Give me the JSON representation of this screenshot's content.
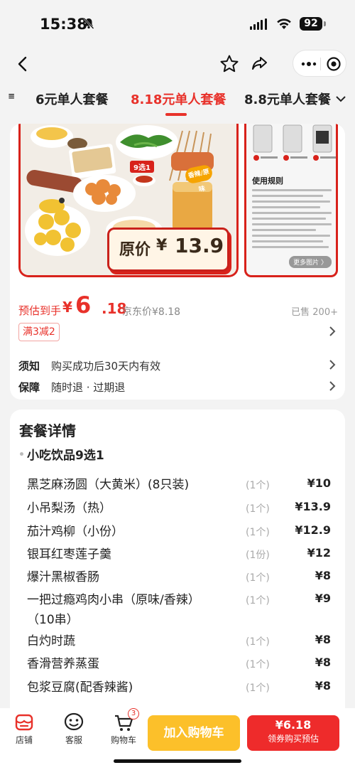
{
  "status": {
    "time": "15:38",
    "battery": "92"
  },
  "tabs": [
    {
      "label": "6元单人套餐",
      "active": false
    },
    {
      "label": "8.18元单人套餐",
      "active": true
    },
    {
      "label": "8.8元单人套餐",
      "active": false
    }
  ],
  "hero": {
    "poster_price": "原价¥ 13.9",
    "poster_prefix": "原价",
    "poster_yen": "¥",
    "poster_value": "13.9",
    "badge_9": "9选1",
    "badge_spicy": "香辣/原味",
    "rules_title": "使用规则",
    "more_images": "更多图片 〉"
  },
  "pricing": {
    "estimate_label": "预估到手",
    "yen": "¥",
    "estimate_int": "6",
    "estimate_dec": ".18",
    "jd_price": "京东价¥8.18",
    "sold": "已售 200+"
  },
  "promo": {
    "label": "满3减2"
  },
  "info": [
    {
      "key": "须知",
      "value": "购买成功后30天内有效"
    },
    {
      "key": "保障",
      "value": "随时退 · 过期退"
    }
  ],
  "details": {
    "title": "套餐详情",
    "group": "小吃饮品9选1",
    "items": [
      {
        "name": "黑芝麻汤圆（大黄米）(8只装)",
        "qty": "(1个)",
        "price": "¥10"
      },
      {
        "name": "小吊梨汤（热）",
        "qty": "(1个)",
        "price": "¥13.9"
      },
      {
        "name": "茄汁鸡柳（小份）",
        "qty": "(1个)",
        "price": "¥12.9"
      },
      {
        "name": "银耳红枣莲子羹",
        "qty": "(1份)",
        "price": "¥12"
      },
      {
        "name": "爆汁黑椒香肠",
        "qty": "(1个)",
        "price": "¥8"
      },
      {
        "name": "一把过瘾鸡肉小串（原味/香辣）（10串）",
        "qty": "(1个)",
        "price": "¥9"
      },
      {
        "name": "白灼时蔬",
        "qty": "(1个)",
        "price": "¥8"
      },
      {
        "name": "香滑营养蒸蛋",
        "qty": "(1个)",
        "price": "¥8"
      },
      {
        "name": "包浆豆腐(配香辣酱)",
        "qty": "(1个)",
        "price": "¥8"
      }
    ]
  },
  "bottom": {
    "store": "店铺",
    "service": "客服",
    "cart": "购物车",
    "cart_count": "3",
    "add_to_cart": "加入购物车",
    "buy_price": "¥6.18",
    "buy_label": "领券购买预估"
  },
  "colors": {
    "accent": "#e8312a",
    "cart_button": "#fcc02a",
    "buy_button": "#ee2b2b"
  },
  "icons": [
    "back-icon",
    "star-icon",
    "share-icon",
    "more-icon",
    "target-icon",
    "store-icon",
    "service-icon",
    "cart-icon",
    "chevron-right-icon",
    "chevron-down-icon"
  ]
}
